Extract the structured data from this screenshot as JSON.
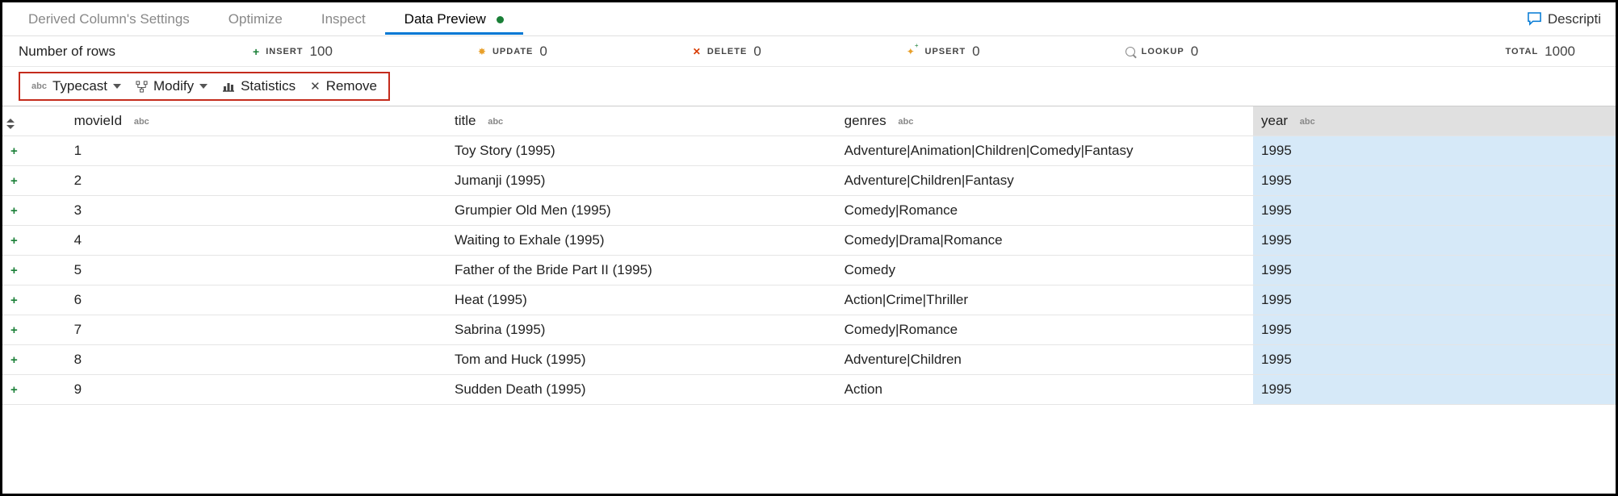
{
  "tabs": {
    "items": [
      {
        "label": "Derived Column's Settings",
        "active": false
      },
      {
        "label": "Optimize",
        "active": false
      },
      {
        "label": "Inspect",
        "active": false
      },
      {
        "label": "Data Preview",
        "active": true
      }
    ],
    "description_label": "Descripti"
  },
  "stats": {
    "label": "Number of rows",
    "insert": {
      "label": "INSERT",
      "value": "100"
    },
    "update": {
      "label": "UPDATE",
      "value": "0"
    },
    "delete": {
      "label": "DELETE",
      "value": "0"
    },
    "upsert": {
      "label": "UPSERT",
      "value": "0"
    },
    "lookup": {
      "label": "LOOKUP",
      "value": "0"
    },
    "total": {
      "label": "TOTAL",
      "value": "1000"
    }
  },
  "toolbar": {
    "typecast": "Typecast",
    "modify": "Modify",
    "statistics": "Statistics",
    "remove": "Remove"
  },
  "columns": {
    "movieId": "movieId",
    "title": "title",
    "genres": "genres",
    "year": "year",
    "type_abc": "abc"
  },
  "rows": [
    {
      "movieId": "1",
      "title": "Toy Story (1995)",
      "genres": "Adventure|Animation|Children|Comedy|Fantasy",
      "year": "1995"
    },
    {
      "movieId": "2",
      "title": "Jumanji (1995)",
      "genres": "Adventure|Children|Fantasy",
      "year": "1995"
    },
    {
      "movieId": "3",
      "title": "Grumpier Old Men (1995)",
      "genres": "Comedy|Romance",
      "year": "1995"
    },
    {
      "movieId": "4",
      "title": "Waiting to Exhale (1995)",
      "genres": "Comedy|Drama|Romance",
      "year": "1995"
    },
    {
      "movieId": "5",
      "title": "Father of the Bride Part II (1995)",
      "genres": "Comedy",
      "year": "1995"
    },
    {
      "movieId": "6",
      "title": "Heat (1995)",
      "genres": "Action|Crime|Thriller",
      "year": "1995"
    },
    {
      "movieId": "7",
      "title": "Sabrina (1995)",
      "genres": "Comedy|Romance",
      "year": "1995"
    },
    {
      "movieId": "8",
      "title": "Tom and Huck (1995)",
      "genres": "Adventure|Children",
      "year": "1995"
    },
    {
      "movieId": "9",
      "title": "Sudden Death (1995)",
      "genres": "Action",
      "year": "1995"
    }
  ]
}
